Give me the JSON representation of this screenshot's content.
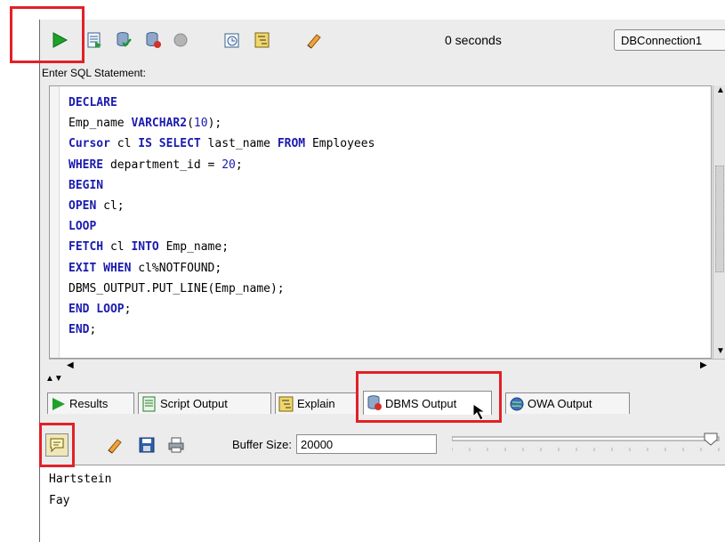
{
  "toolbar": {
    "elapsed_time": "0 seconds",
    "connection": "DBConnection1",
    "icons": [
      "run-statement-icon",
      "run-script-icon",
      "commit-icon",
      "rollback-icon",
      "cancel-icon",
      "sql-history-icon",
      "explain-plan-icon",
      "clear-icon"
    ]
  },
  "editor": {
    "label": "Enter SQL Statement:",
    "lines": [
      {
        "kw": "DECLARE",
        "rest": ""
      },
      {
        "kw": "",
        "rest": "Emp_name ",
        "kw2": "VARCHAR2",
        "p": "(",
        "num": "10",
        "tail": ");"
      },
      {
        "kw": "Cursor",
        "rest": " cl ",
        "kw2": "IS SELECT",
        "p": " last_name ",
        "num": "",
        "kw3": "FROM",
        "tail": " Employees"
      },
      {
        "kw": "WHERE",
        "rest": " department_id = ",
        "num": "20",
        "tail": ";"
      },
      {
        "kw": "BEGIN",
        "rest": ""
      },
      {
        "kw": "OPEN",
        "rest": " cl;"
      },
      {
        "kw": "LOOP",
        "rest": ""
      },
      {
        "kw": "FETCH",
        "rest": " cl ",
        "kw2": "INTO",
        "tail": " Emp_name;"
      },
      {
        "kw": "EXIT WHEN",
        "rest": " cl%NOTFOUND;"
      },
      {
        "kw": "",
        "rest": "DBMS_OUTPUT.PUT_LINE(Emp_name);"
      },
      {
        "kw": "END LOOP",
        "rest": ";"
      },
      {
        "kw": "END",
        "rest": ";"
      }
    ]
  },
  "tabs": [
    {
      "label": "Results",
      "icon": "run-icon"
    },
    {
      "label": "Script Output",
      "icon": "script-icon"
    },
    {
      "label": "Explain",
      "icon": "explain-icon"
    },
    {
      "label": "DBMS Output",
      "icon": "dbms-output-icon",
      "active": true
    },
    {
      "label": "OWA Output",
      "icon": "owa-output-icon"
    }
  ],
  "dbms": {
    "buffer_label": "Buffer Size:",
    "buffer_value": "20000",
    "output_lines": [
      "Hartstein",
      "Fay"
    ]
  },
  "colors": {
    "highlight": "#e32027",
    "keyword": "#1b1bb0"
  }
}
